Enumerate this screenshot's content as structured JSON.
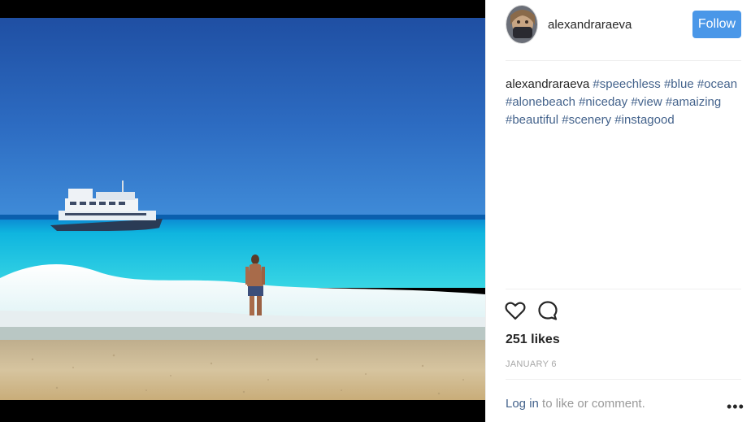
{
  "post": {
    "username": "alexandraraeva",
    "follow_label": "Follow",
    "caption": {
      "author": "alexandraraeva",
      "hashtags": [
        "#speechless",
        "#blue",
        "#ocean",
        "#alonebeach",
        "#niceday",
        "#view",
        "#amaizing",
        "#beautiful",
        "#scenery",
        "#instagood"
      ]
    },
    "likes": "251 likes",
    "date": "JANUARY 6",
    "login_link": "Log in",
    "login_suffix": " to like or comment.",
    "more_label": "•••"
  },
  "icons": {
    "like": "heart-icon",
    "comment": "comment-icon",
    "more": "more-options-icon"
  },
  "colors": {
    "follow_button": "#4a97e8",
    "link": "#44638c"
  }
}
